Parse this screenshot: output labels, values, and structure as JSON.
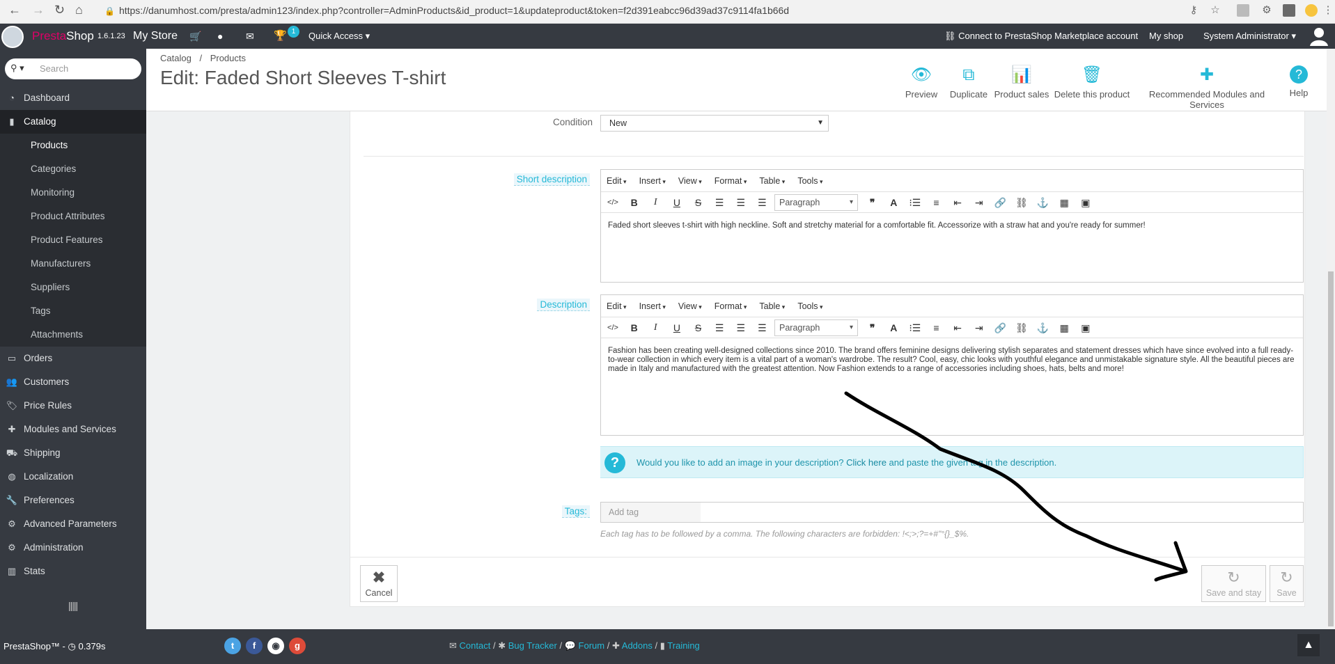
{
  "browser": {
    "url": "https://danumhost.com/presta/admin123/index.php?controller=AdminProducts&id_product=1&updateproduct&token=f2d391eabcc96d39ad37c9114fa1b66d"
  },
  "topbar": {
    "brand": "PrestaShop",
    "brand_accent": "Presta",
    "brand_rest": "Shop",
    "version": "1.6.1.23",
    "store_name": "My Store",
    "notification_count": "1",
    "quick_access": "Quick Access",
    "marketplace": "Connect to PrestaShop Marketplace account",
    "my_shop": "My shop",
    "user": "System Administrator"
  },
  "sidebar": {
    "search_placeholder": "Search",
    "items": [
      {
        "label": "Dashboard",
        "icon": "dashboard-icon"
      },
      {
        "label": "Catalog",
        "icon": "book-icon"
      },
      {
        "label": "Orders",
        "icon": "credit-card-icon"
      },
      {
        "label": "Customers",
        "icon": "users-icon"
      },
      {
        "label": "Price Rules",
        "icon": "tag-icon"
      },
      {
        "label": "Modules and Services",
        "icon": "puzzle-icon"
      },
      {
        "label": "Shipping",
        "icon": "truck-icon"
      },
      {
        "label": "Localization",
        "icon": "globe-icon"
      },
      {
        "label": "Preferences",
        "icon": "wrench-icon"
      },
      {
        "label": "Advanced Parameters",
        "icon": "cogs-icon"
      },
      {
        "label": "Administration",
        "icon": "cog-icon"
      },
      {
        "label": "Stats",
        "icon": "bar-chart-icon"
      }
    ],
    "catalog_sub": [
      "Products",
      "Categories",
      "Monitoring",
      "Product Attributes",
      "Product Features",
      "Manufacturers",
      "Suppliers",
      "Tags",
      "Attachments"
    ]
  },
  "header": {
    "breadcrumb_1": "Catalog",
    "breadcrumb_sep": "/",
    "breadcrumb_2": "Products",
    "title": "Edit: Faded Short Sleeves T-shirt",
    "toolbar": [
      "Preview",
      "Duplicate",
      "Product sales",
      "Delete this product",
      "Recommended Modules and Services",
      "Help"
    ]
  },
  "form": {
    "condition_label": "Condition",
    "condition_value": "New",
    "short_desc_label": "Short description",
    "desc_label": "Description",
    "editor_menu": [
      "Edit",
      "Insert",
      "View",
      "Format",
      "Table",
      "Tools"
    ],
    "paragraph": "Paragraph",
    "short_desc_text": "Faded short sleeves t-shirt with high neckline. Soft and stretchy material for a comfortable fit. Accessorize with a straw hat and you're ready for summer!",
    "desc_text": "Fashion has been creating well-designed collections since 2010. The brand offers feminine designs delivering stylish separates and statement dresses which have since evolved into a full ready-to-wear collection in which every item is a vital part of a woman's wardrobe. The result? Cool, easy, chic looks with youthful elegance and unmistakable signature style. All the beautiful pieces are made in Italy and manufactured with the greatest attention. Now Fashion extends to a range of accessories including shoes, hats, belts and more!",
    "alert_text_1": "Would you like to add an image in your description?",
    "alert_link": "Click here",
    "alert_text_2": "and paste the given tag in the description.",
    "tags_label": "Tags:",
    "tags_placeholder": "Add tag",
    "tags_help": "Each tag has to be followed by a comma. The following characters are forbidden: !<;>;?=+#\"°{}_$%.",
    "cancel": "Cancel",
    "save_and_stay": "Save and stay",
    "save": "Save"
  },
  "footer": {
    "version": "PrestaShop™ - ",
    "load_time": "0.379s",
    "links": [
      "Contact",
      "Bug Tracker",
      "Forum",
      "Addons",
      "Training"
    ],
    "sep": "/"
  },
  "colors": {
    "accent": "#25b9d7",
    "dark": "#363a41",
    "brand_pink": "#df0067"
  }
}
